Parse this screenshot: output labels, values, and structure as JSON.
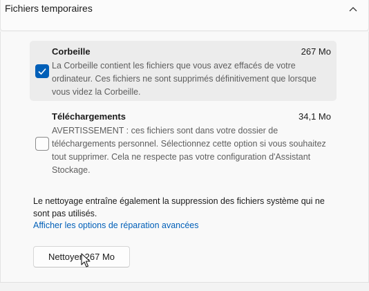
{
  "header": {
    "title": "Fichiers temporaires",
    "collapse_icon": "chevron-up-icon"
  },
  "items": [
    {
      "title": "Corbeille",
      "size": "267 Mo",
      "checked": true,
      "description": "La Corbeille contient les fichiers que vous avez effacés de votre ordinateur. Ces fichiers ne sont supprimés définitivement que lorsque vous videz la Corbeille."
    },
    {
      "title": "Téléchargements",
      "size": "34,1 Mo",
      "checked": false,
      "description": "AVERTISSEMENT : ces fichiers sont dans votre dossier de téléchargements personnel. Sélectionnez cette option si vous souhaitez tout supprimer. Cela ne respecte pas votre configuration d'Assistant Stockage."
    }
  ],
  "note": "Le nettoyage entraîne également la suppression des fichiers système qui ne sont pas utilisés.",
  "repair_link": "Afficher les options de réparation avancées",
  "clean_button": "Nettoyer 267 Mo",
  "colors": {
    "accent": "#005fb8",
    "link": "#005fb8",
    "description_text": "#5d5d5d"
  }
}
